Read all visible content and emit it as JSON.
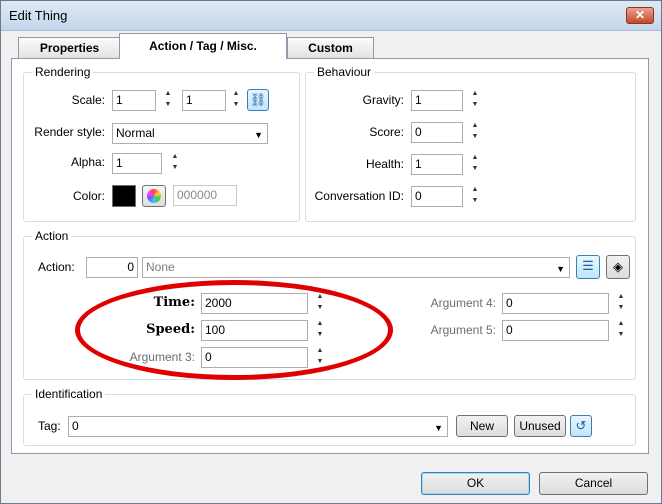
{
  "window": {
    "title": "Edit Thing",
    "close_glyph": "✕"
  },
  "tabs": [
    {
      "label": "Properties",
      "active": false
    },
    {
      "label": "Action / Tag / Misc.",
      "active": true
    },
    {
      "label": "Custom",
      "active": false
    }
  ],
  "rendering": {
    "title": "Rendering",
    "scale_label": "Scale:",
    "scale_x": "1",
    "scale_y": "1",
    "render_style_label": "Render style:",
    "render_style_value": "Normal",
    "alpha_label": "Alpha:",
    "alpha_value": "1",
    "color_label": "Color:",
    "color_value": "000000"
  },
  "behaviour": {
    "title": "Behaviour",
    "gravity_label": "Gravity:",
    "gravity_value": "1",
    "score_label": "Score:",
    "score_value": "0",
    "health_label": "Health:",
    "health_value": "1",
    "conversation_label": "Conversation ID:",
    "conversation_value": "0"
  },
  "action": {
    "title": "Action",
    "action_label": "Action:",
    "action_number": "0",
    "action_value": "None",
    "arg1_label": "Time:",
    "arg1_value": "2000",
    "arg2_label": "Speed:",
    "arg2_value": "100",
    "arg3_label": "Argument 3:",
    "arg3_value": "0",
    "arg4_label": "Argument 4:",
    "arg4_value": "0",
    "arg5_label": "Argument 5:",
    "arg5_value": "0"
  },
  "identification": {
    "title": "Identification",
    "tag_label": "Tag:",
    "tag_value": "0",
    "new_label": "New",
    "unused_label": "Unused"
  },
  "footer": {
    "ok_label": "OK",
    "cancel_label": "Cancel"
  },
  "colors": {
    "accent": "#3c7fb1",
    "annotation": "#e00000",
    "swatch": "#000000"
  },
  "icons": [
    "close-icon",
    "link-icon",
    "color-wheel-icon",
    "list-icon",
    "browse-icon",
    "undo-icon",
    "dropdown-arrow-icon",
    "spinner-icon"
  ]
}
